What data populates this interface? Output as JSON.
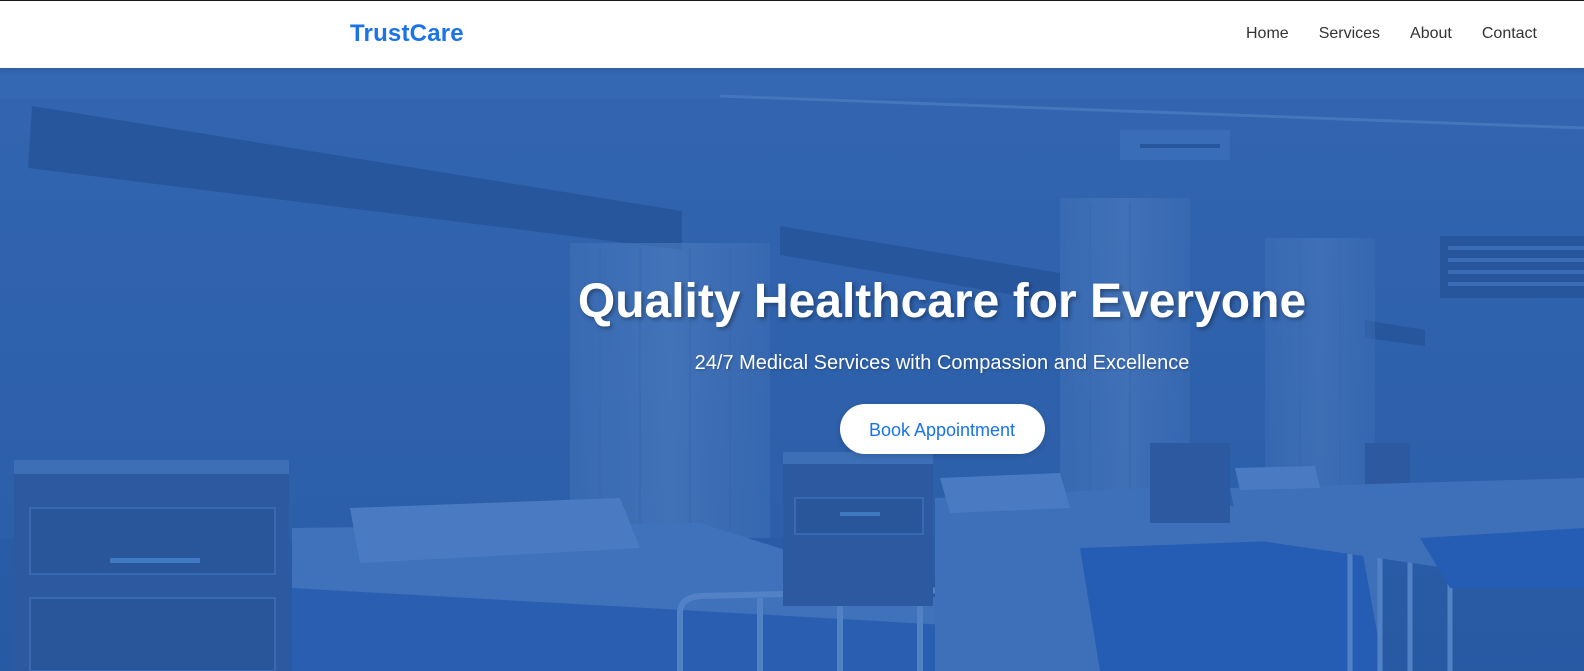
{
  "navbar": {
    "brand": "TrustCare",
    "links": [
      {
        "label": "Home"
      },
      {
        "label": "Services"
      },
      {
        "label": "About"
      },
      {
        "label": "Contact"
      }
    ]
  },
  "hero": {
    "title": "Quality Healthcare for Everyone",
    "subtitle": "24/7 Medical Services with Compassion and Excellence",
    "cta_label": "Book Appointment",
    "background": "hospital-ward-beds-photo"
  },
  "colors": {
    "brand": "#1a73e8",
    "hero_tint": "#2f63aa",
    "nav_text": "#333333",
    "white": "#ffffff"
  }
}
